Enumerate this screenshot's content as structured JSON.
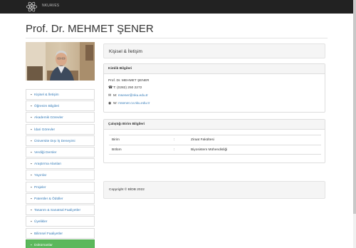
{
  "navbar": {
    "brand": "NKUAVES",
    "logo_icon": "atom-logo-icon"
  },
  "page_title": "Prof. Dr. MEHMET ŞENER",
  "sidebar": {
    "items": [
      {
        "label": "Kişisel & İletişim",
        "icon": "institution-icon",
        "glyph": "▪"
      },
      {
        "label": "Öğrenim Bilgileri",
        "icon": "graduation-cap-icon",
        "glyph": "▪"
      },
      {
        "label": "Akademik Görevler",
        "icon": "institution-icon",
        "glyph": "▪"
      },
      {
        "label": "İdari Görevler",
        "icon": "hospital-icon",
        "glyph": "▪"
      },
      {
        "label": "Üniversite Dışı İş Deneyimi",
        "icon": "institution-icon",
        "glyph": "▪"
      },
      {
        "label": "Verdiği Dersler",
        "icon": "graduation-cap-icon",
        "glyph": "▪"
      },
      {
        "label": "Araştırma Alanları",
        "icon": "users-icon",
        "glyph": "▪"
      },
      {
        "label": "Yayınlar",
        "icon": "book-icon",
        "glyph": "▪"
      },
      {
        "label": "Projeler",
        "icon": "gears-icon",
        "glyph": "▪"
      },
      {
        "label": "Patentler & Ödüller",
        "icon": "trophy-icon",
        "glyph": "▪"
      },
      {
        "label": "Tasarım & Sanatsal Faaliyetler",
        "icon": "trophy-icon",
        "glyph": "▪"
      },
      {
        "label": "Üyelikler",
        "icon": "trophy-icon",
        "glyph": "▪"
      },
      {
        "label": "Bilimsel Faaliyetler",
        "icon": "sitemap-icon",
        "glyph": "▪"
      },
      {
        "label": "Dokümanlar",
        "icon": "bookmark-icon",
        "glyph": "▪",
        "active": true
      }
    ]
  },
  "section_header": "Kişisel & İletişim",
  "identity_panel": {
    "heading": "Kimlik Bilgileri",
    "name": "Prof. Dr. MEHMET ŞENER",
    "phone_prefix": "T:",
    "phone": "(0282) 250 2272",
    "email_prefix": "M:",
    "email": "msener@nku.edu.tr",
    "web_prefix": "W:",
    "web": "msener.cv.nku.edu.tr"
  },
  "unit_panel": {
    "heading": "Çalıştığı Birim Bilgileri",
    "rows": [
      {
        "label": "Birim",
        "sep": ":",
        "value": "Ziraat Fakültesi"
      },
      {
        "label": "Bölüm",
        "sep": ":",
        "value": "Biyosistem Mühendisliği"
      }
    ]
  },
  "footer": "Copyright © BİDB 2022",
  "colors": {
    "navbar": "#222222",
    "link": "#337ab7",
    "active": "#5cb85c"
  }
}
